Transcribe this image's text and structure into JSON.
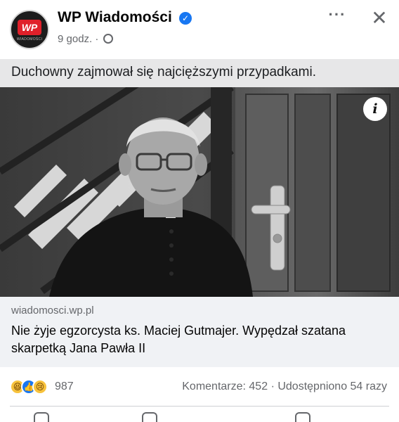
{
  "post": {
    "page_name": "WP Wiadomości",
    "verified_icon": "verified-badge-icon",
    "time": "9 godz.",
    "separator": "·",
    "privacy_icon": "globe-icon",
    "more_label": "···",
    "close_label": "✕",
    "logo_text": "WP",
    "logo_subtext": "WIADOMOŚCI",
    "text": "Duchowny zajmował się najcięższymi przypadkami."
  },
  "photo": {
    "info_label": "i"
  },
  "link": {
    "domain": "wiadomosci.wp.pl",
    "title": "Nie żyje egzorcysta ks. Maciej Gutmajer. Wypędzał szatana skarpetką Jana Pawła II"
  },
  "stats": {
    "reaction_icons": [
      "haha-reaction-icon",
      "like-reaction-icon",
      "sad-reaction-icon"
    ],
    "reaction_count": "987",
    "comments": "Komentarze: 452",
    "separator": "·",
    "shares": "Udostępniono 54 razy"
  },
  "colors": {
    "accent": "#1877f2",
    "logo_red": "#e0202a",
    "secondary_text": "#65676b"
  }
}
